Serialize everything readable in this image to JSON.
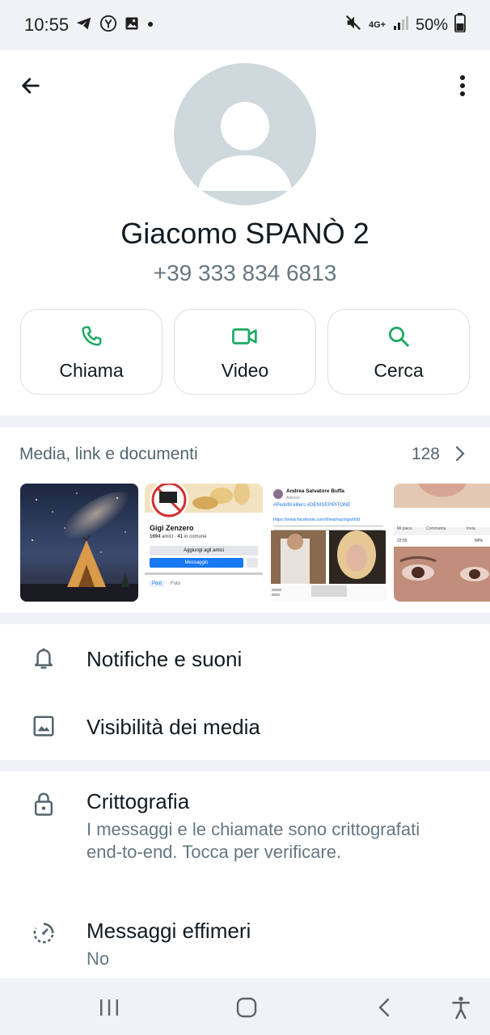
{
  "status_bar": {
    "time": "10:55",
    "network": "4G+",
    "battery": "50%",
    "icons": [
      "telegram-icon",
      "yandex-icon",
      "image-icon",
      "dot-icon",
      "mute-icon",
      "signal-icon",
      "battery-icon"
    ]
  },
  "contact": {
    "name": "Giacomo SPANÒ 2",
    "phone": "+39 333 834 6813"
  },
  "actions": {
    "call_label": "Chiama",
    "video_label": "Video",
    "search_label": "Cerca"
  },
  "media": {
    "title": "Media, link e documenti",
    "count": "128",
    "thumbs": [
      {
        "name": "Gigi Zenzero",
        "stats_bold": "1694",
        "stats_text": "amici · ",
        "stats_bold2": "41",
        "stats_text2": "in comune",
        "add_friend": "Aggiungi agli amici",
        "message": "Messaggio",
        "tab_post": "Post",
        "tab_photo": "Foto"
      },
      {
        "author": "Andrea Salvatore Buffa",
        "time": "Adesso · ",
        "hashtags": "#Pedofili killers #DENISEPIPITONE",
        "link": "https://www.facebook.com/theamazingw0rld"
      },
      {
        "like": "Mi piace",
        "comment": "Commenta",
        "share": "Invia",
        "status_time": "22:55",
        "status_battery": "84%"
      }
    ]
  },
  "settings": {
    "notifications": "Notifiche e suoni",
    "media_visibility": "Visibilità dei media",
    "encryption_title": "Crittografia",
    "encryption_desc": "I messaggi e le chiamate sono crittografati end-to-end. Tocca per verificare.",
    "ephemeral_title": "Messaggi effimeri",
    "ephemeral_value": "No"
  },
  "colors": {
    "accent": "#1daa61",
    "text_primary": "#111b21",
    "text_secondary": "#667781",
    "background": "#f0f2f5"
  }
}
